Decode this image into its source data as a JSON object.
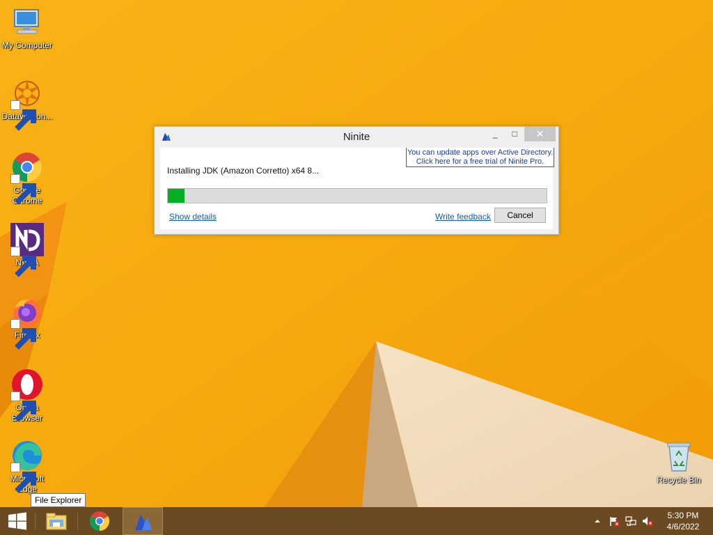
{
  "desktop": {
    "icons": [
      {
        "label": "My Computer",
        "icon": "computer-icon"
      },
      {
        "label": "DataWagon...",
        "icon": "datawagon-icon"
      },
      {
        "label": "Google Chrome",
        "icon": "chrome-icon"
      },
      {
        "label": "NVDA",
        "icon": "nvda-icon"
      },
      {
        "label": "Firefox",
        "icon": "firefox-icon"
      },
      {
        "label": "Opera Browser",
        "icon": "opera-icon"
      },
      {
        "label": "Microsoft Edge",
        "icon": "edge-icon"
      },
      {
        "label": "Recycle Bin",
        "icon": "recycle-bin-icon"
      }
    ],
    "tooltip": "File Explorer"
  },
  "ninite": {
    "title": "Ninite",
    "window_buttons": {
      "minimize": "_",
      "maximize": "□",
      "close": "✕"
    },
    "ad_line1": "You can update apps over Active Directory.",
    "ad_line2": "Click here for a free trial of Ninite Pro.",
    "status": "Installing JDK (Amazon Corretto) x64 8...",
    "progress_fraction": 0.044,
    "show_details": "Show details",
    "write_feedback": "Write feedback",
    "cancel": "Cancel"
  },
  "taskbar": {
    "apps": [
      "file-explorer-icon",
      "chrome-icon",
      "ninite-icon"
    ],
    "tray": [
      "show-hidden-icons-icon",
      "action-center-flag-icon",
      "network-icon",
      "volume-muted-icon"
    ],
    "clock_time": "5:30 PM",
    "clock_date": "4/6/2022"
  },
  "colors": {
    "wallpaper": "#f6ab10",
    "taskbar": "#6b4a22",
    "progress_fill": "#06b025",
    "link": "#0b5fb4"
  }
}
